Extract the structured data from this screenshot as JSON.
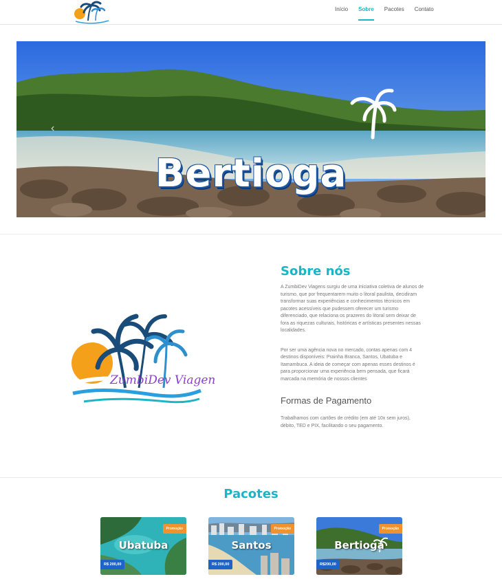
{
  "nav": {
    "logo_text": "ZumbiDev Viagens",
    "links": [
      {
        "label": "Início",
        "active": false
      },
      {
        "label": "Sobre",
        "active": true
      },
      {
        "label": "Pacotes",
        "active": false
      },
      {
        "label": "Contato",
        "active": false
      }
    ]
  },
  "hero": {
    "title": "Bertioga",
    "prev_icon": "chevron-left-icon"
  },
  "about": {
    "logo_text": "ZumbiDev Viagens",
    "heading": "Sobre nós",
    "paragraph1": "A ZumbiDev Viagens surgiu de uma iniciativa coletiva de alunos de turismo, que por frequentarem muito o litoral paulista, decidiram transformar suas experiências e conhecimentos técnicos em pacotes acessíveis que pudessem oferecer um turismo diferenciado, que relaciona os prazeres do litoral sem deixar de fora as riquezas culturais, históricas e artísticas presentes nessas localidades.",
    "paragraph2": "Por ser uma agência nova no mercado, contas apenas com 4 destinos disponíveis: Prainha Branca, Santos, Ubatuba e Itamambuca. A ideia de começar com apenas esses destinos é para proporcionar uma experiência bem pensada, que ficará marcada na memória de nossos clientes",
    "payment_heading": "Formas de Pagamento",
    "payment_text": "Trabalhamos com cartões de crédito (em até 10x sem juros), débito, TED e PIX, facilitando o seu pagamento."
  },
  "pacotes": {
    "heading": "Pacotes",
    "cards": [
      {
        "name": "Ubatuba",
        "badge": "Promoção",
        "price": "R$ 200,00"
      },
      {
        "name": "Santos",
        "badge": "Promoção",
        "price": "R$ 200,00"
      },
      {
        "name": "Bertioga",
        "badge": "Promoção",
        "price": "R$200,00"
      }
    ]
  },
  "colors": {
    "accent": "#1cb4c7",
    "badge": "#f0922d",
    "price": "#1e64c8"
  }
}
